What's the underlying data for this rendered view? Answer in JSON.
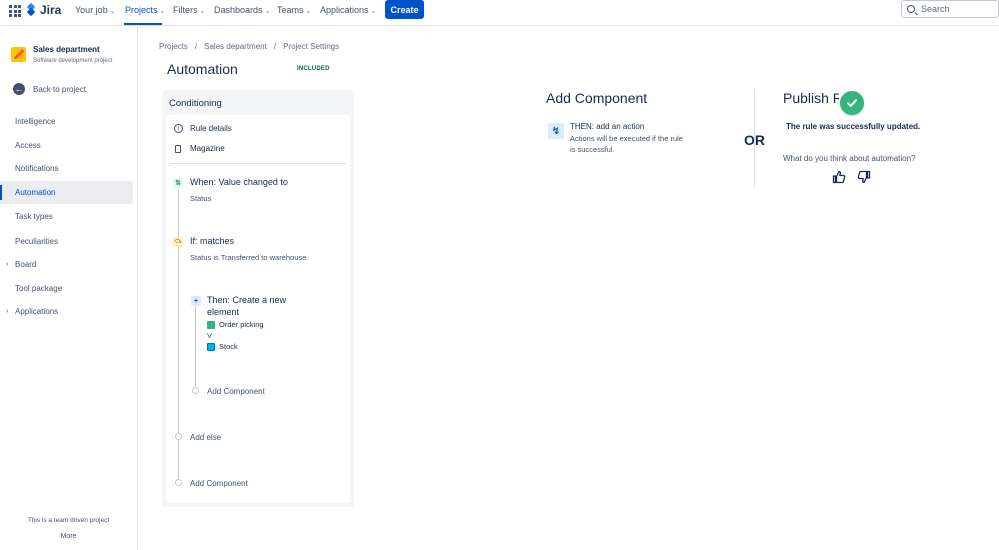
{
  "topnav": {
    "logo": "Jira",
    "items": [
      {
        "label": "Your job"
      },
      {
        "label": "Projects"
      },
      {
        "label": "Filters"
      },
      {
        "label": "Dashboards"
      },
      {
        "label": "Teams"
      },
      {
        "label": "Applications"
      }
    ],
    "create_label": "Create",
    "search_placeholder": "Search",
    "accent_color": "#0052cc"
  },
  "sidebar": {
    "project_name": "Sales department",
    "project_type": "Software development project",
    "back_label": "Back to project",
    "items": [
      {
        "label": "Intelligence"
      },
      {
        "label": "Access"
      },
      {
        "label": "Notifications"
      },
      {
        "label": "Automation"
      },
      {
        "label": "Task types"
      },
      {
        "label": "Peculiarities"
      },
      {
        "label": "Board"
      },
      {
        "label": "Tool package"
      },
      {
        "label": "Applications"
      }
    ],
    "active_item": "Automation",
    "footer_text": "This is a team driven project",
    "footer_more": "More"
  },
  "breadcrumb": [
    "Projects",
    "Sales department",
    "Project Settings"
  ],
  "page": {
    "title": "Automation",
    "badge": "INCLUDED"
  },
  "rule": {
    "panel_title": "Conditioning",
    "rule_details": "Rule details",
    "magazine": "Magazine",
    "when": {
      "title": "When: Value changed to",
      "sub": "Status"
    },
    "if": {
      "title": "If: matches",
      "sub": "Status is Transferred to warehouse"
    },
    "then": {
      "title_line1": "Then: Create a new",
      "title_line2": "element",
      "tag1": "Order picking",
      "separator": "V",
      "tag2": "Stock"
    },
    "add_component_inner": "Add Component",
    "add_else": "Add else",
    "add_component_outer": "Add Component"
  },
  "add_component": {
    "title": "Add Component",
    "action_title": "THEN: add an action",
    "action_desc": "Actions will be executed if the rule is successful.",
    "or": "OR"
  },
  "publish": {
    "title": "Publish Rule",
    "success": "The rule was successfully updated.",
    "feedback_question": "What do you think about automation?"
  }
}
